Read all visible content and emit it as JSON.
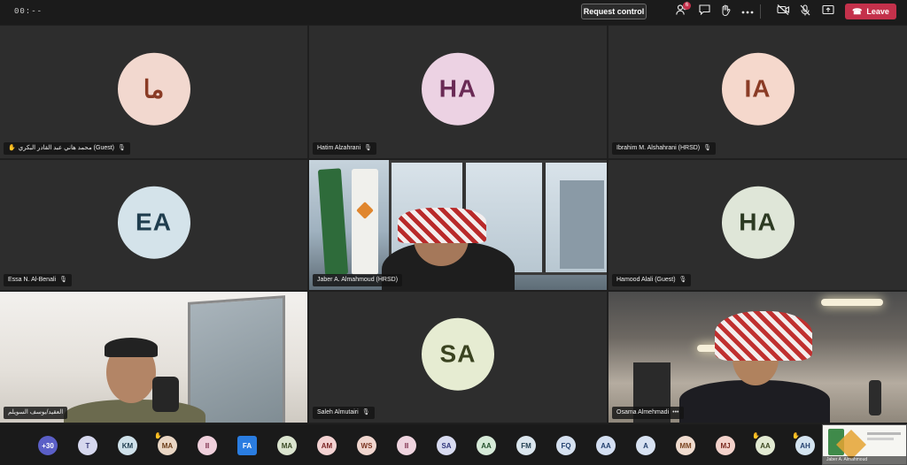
{
  "topbar": {
    "timer": "00:--",
    "request_control": "Request control",
    "people_badge": "6",
    "leave_label": "Leave",
    "icons": [
      "people-icon",
      "chat-icon",
      "raise-hand-icon",
      "more-icon",
      "camera-off-icon",
      "mic-off-icon",
      "share-icon"
    ]
  },
  "tiles": [
    {
      "name": "محمد هاني عبد القادر البكري (Guest)",
      "initials": "ما",
      "bg": "#f2d8cf",
      "fg": "#8a3b25",
      "hand": true
    },
    {
      "name": "Hatim Alzahrani",
      "initials": "HA",
      "bg": "#ecd2e3",
      "fg": "#6a2a55",
      "hand": false
    },
    {
      "name": "Ibrahim M. Alshahrani (HRSD)",
      "initials": "IA",
      "bg": "#f5d8cc",
      "fg": "#8a3b25",
      "hand": false
    },
    {
      "name": "Essa N. Al-Benali",
      "initials": "EA",
      "bg": "#d4e3ea",
      "fg": "#1f3d4e",
      "hand": false
    },
    {
      "name": "Jaber A. Almahmoud (HRSD)",
      "initials": "",
      "bg": "",
      "fg": "",
      "hand": false
    },
    {
      "name": "Hamood Alali (Guest)",
      "initials": "HA",
      "bg": "#dfe6d8",
      "fg": "#2c3a22",
      "hand": false
    },
    {
      "name": "العقيد/يوسف السويلم",
      "initials": "",
      "bg": "",
      "fg": "",
      "hand": false
    },
    {
      "name": "Saleh Almutairi",
      "initials": "SA",
      "bg": "#e6ecd2",
      "fg": "#3a4320",
      "hand": false
    },
    {
      "name": "Osama Almehmadi",
      "initials": "",
      "bg": "",
      "fg": "",
      "hand": false
    }
  ],
  "bottom": {
    "participants": [
      {
        "label": "+30",
        "bg": "#5b5fc7",
        "fg": "#ffffff"
      },
      {
        "label": "T",
        "bg": "#d6d8ee",
        "fg": "#3a3d7a"
      },
      {
        "label": "KM",
        "bg": "#cfe1ea",
        "fg": "#1f3d4e"
      },
      {
        "label": "MA",
        "bg": "#ead7c5",
        "fg": "#6a3c17",
        "hand": true
      },
      {
        "label": "II",
        "bg": "#f0d0dc",
        "fg": "#7a2a48"
      },
      {
        "label": "FA",
        "bg": "#2a7de1",
        "fg": "#ffffff"
      },
      {
        "label": "MA",
        "bg": "#dbe4cf",
        "fg": "#3a4a24"
      },
      {
        "label": "AM",
        "bg": "#f3d2d2",
        "fg": "#7a2424"
      },
      {
        "label": "WS",
        "bg": "#f0d6cf",
        "fg": "#7a3420"
      },
      {
        "label": "II",
        "bg": "#efd4df",
        "fg": "#7a2a48"
      },
      {
        "label": "SA",
        "bg": "#d8dbf0",
        "fg": "#2f357a"
      },
      {
        "label": "AA",
        "bg": "#d6ead8",
        "fg": "#24502c"
      },
      {
        "label": "FM",
        "bg": "#dbe6ee",
        "fg": "#1f3d4e"
      },
      {
        "label": "FQ",
        "bg": "#d6e1f0",
        "fg": "#23406e"
      },
      {
        "label": "AA",
        "bg": "#d4dff2",
        "fg": "#23406e"
      },
      {
        "label": "A",
        "bg": "#d8e2f2",
        "fg": "#23406e"
      },
      {
        "label": "MM",
        "bg": "#f0dccf",
        "fg": "#7a4420"
      },
      {
        "label": "MJ",
        "bg": "#f3d2cb",
        "fg": "#7a2a20"
      },
      {
        "label": "AA",
        "bg": "#e2ead2",
        "fg": "#3e4a22",
        "hand": true
      },
      {
        "label": "AH",
        "bg": "#d4e4f0",
        "fg": "#23406e",
        "hand": true
      }
    ],
    "share_caption": "Jaber A. Almahmoud"
  }
}
